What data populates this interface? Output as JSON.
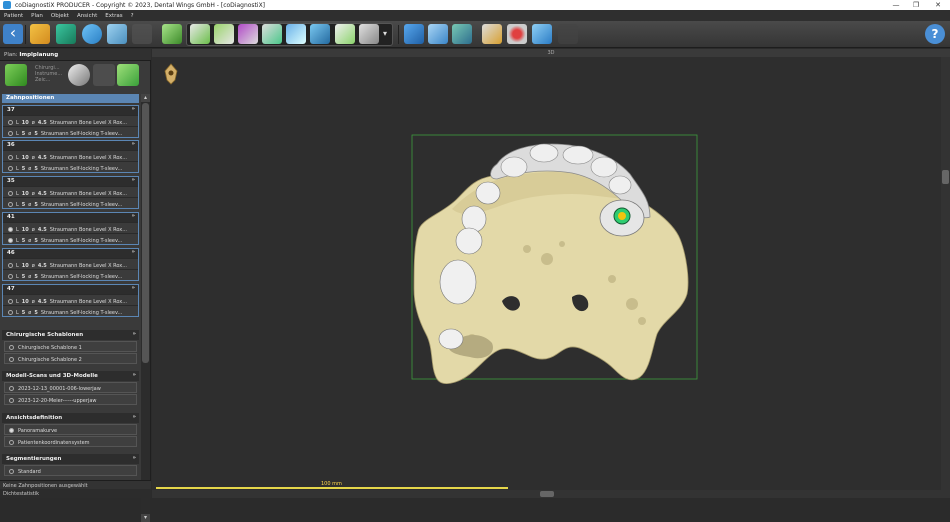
{
  "window": {
    "title": "coDiagnostiX PRODUCER - Copyright © 2023, Dental Wings GmbH - [coDiagnostiX]",
    "minimize_glyph": "—",
    "maximize_glyph": "❐",
    "close_glyph": "✕"
  },
  "menu": [
    "Patient",
    "Plan",
    "Objekt",
    "Ansicht",
    "Extras",
    "?"
  ],
  "toolbar": {
    "back_label": "‹",
    "help_label": "?",
    "dropdown_glyph": "▾",
    "icons": [
      "back-icon",
      "open-folder-icon",
      "model-icon",
      "segment-icon",
      "sleeve-icon",
      "disabled-icon",
      "green-cube-icon",
      "implant-tool-1-icon",
      "implant-tool-2-icon",
      "implant-tool-3-icon",
      "implant-tool-4-icon",
      "implant-tool-5-icon",
      "implant-tool-6-icon",
      "implant-tool-7-icon",
      "implant-tool-8-icon",
      "move-icon",
      "rotate-icon",
      "nerve-icon",
      "measure-icon",
      "annotation-icon",
      "view-icon",
      "undo-icon",
      "help-icon"
    ]
  },
  "left_panel": {
    "plan_label": "Plan:",
    "plan_name": "Implplanung",
    "tool_text": [
      "Chirurgi...",
      "Instrume...",
      "Zeic..."
    ],
    "implant_header": "Zahnpositionen",
    "groups": [
      {
        "tooth": "37",
        "rows": [
          {
            "len": "10",
            "dia": "4.5",
            "desc": "Straumann Bone Level X Rox..."
          },
          {
            "len": "5",
            "dia": "5",
            "desc": "Straumann Self-locking T-sleev..."
          }
        ]
      },
      {
        "tooth": "36",
        "rows": [
          {
            "len": "10",
            "dia": "4.5",
            "desc": "Straumann Bone Level X Rox..."
          },
          {
            "len": "5",
            "dia": "5",
            "desc": "Straumann Self-locking T-sleev..."
          }
        ]
      },
      {
        "tooth": "35",
        "rows": [
          {
            "len": "10",
            "dia": "4.5",
            "desc": "Straumann Bone Level X Rox..."
          },
          {
            "len": "5",
            "dia": "5",
            "desc": "Straumann Self-locking T-sleev..."
          }
        ]
      },
      {
        "tooth": "41",
        "rows": [
          {
            "len": "10",
            "dia": "4.5",
            "desc": "Straumann Bone Level X Rox..."
          },
          {
            "len": "5",
            "dia": "5",
            "desc": "Straumann Self-locking T-sleev..."
          }
        ]
      },
      {
        "tooth": "46",
        "rows": [
          {
            "len": "10",
            "dia": "4.5",
            "desc": "Straumann Bone Level X Rox..."
          },
          {
            "len": "5",
            "dia": "5",
            "desc": "Straumann Self-locking T-sleev..."
          }
        ]
      },
      {
        "tooth": "47",
        "rows": [
          {
            "len": "10",
            "dia": "4.5",
            "desc": "Straumann Bone Level X Rox..."
          },
          {
            "len": "5",
            "dia": "5",
            "desc": "Straumann Self-locking T-sleev..."
          }
        ]
      }
    ],
    "sections": [
      {
        "title": "Chirurgische Schablonen",
        "items": [
          "Chirurgische Schablone 1",
          "Chirurgische Schablone 2"
        ]
      },
      {
        "title": "Modell-Scans und 3D-Modelle",
        "items": [
          "2023-12-13_00001-006-lowerjaw",
          "2023-12-20-Meier------upperjaw"
        ]
      },
      {
        "title": "Ansichtsdefinition",
        "items": [
          "Panoramakurve",
          "Patientenkoordinatensystem"
        ]
      },
      {
        "title": "Segmentierungen",
        "items": [
          "Standard"
        ]
      }
    ],
    "status": "Keine Zahnpositionen ausgewählt",
    "bottom": "Dichtestatistik",
    "len_prefix": "L",
    "dia_prefix": "ø"
  },
  "viewport": {
    "title": "3D",
    "scale_label": "100 mm"
  },
  "colors": {
    "accent": "#5b86b4",
    "bone": "#e3d9a8",
    "guide": "#dcdcdc",
    "bbox": "#3d9b3d",
    "scale": "#e5d64a"
  }
}
